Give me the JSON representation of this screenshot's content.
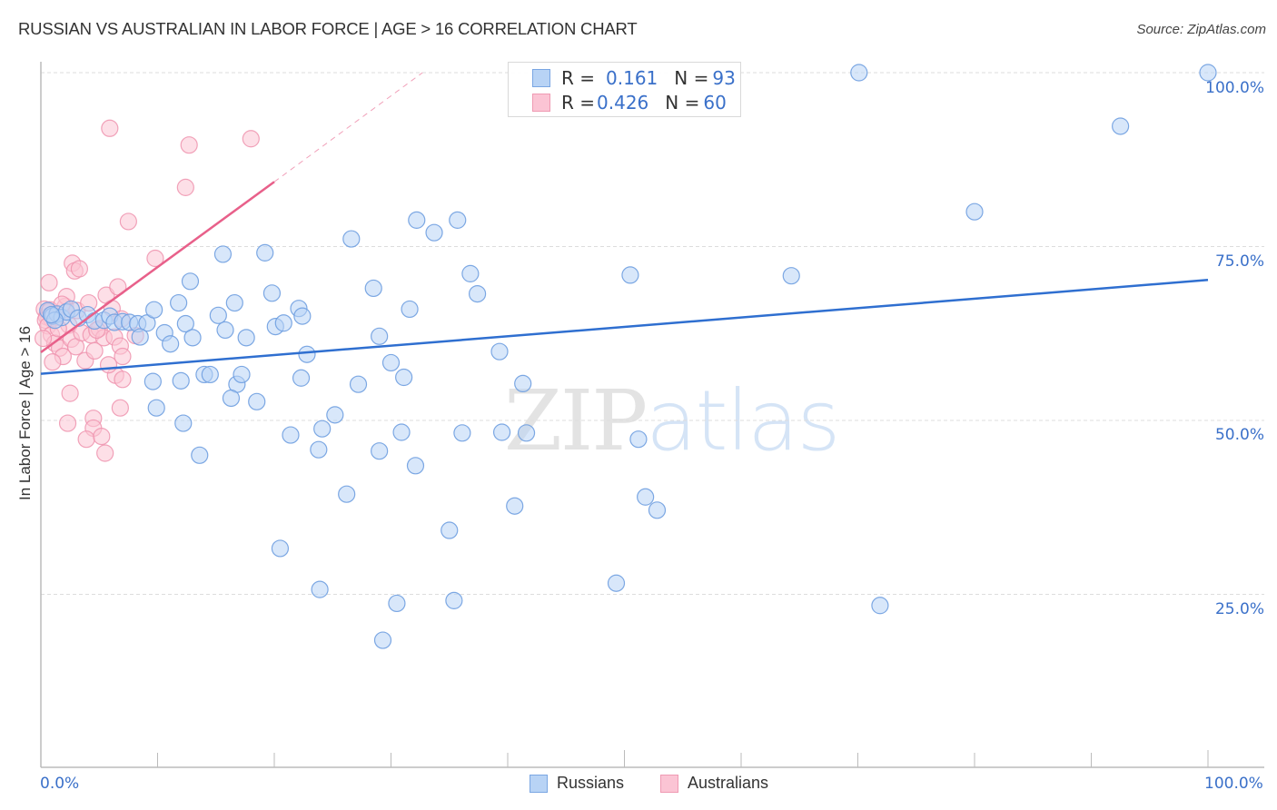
{
  "header": {
    "title": "RUSSIAN VS AUSTRALIAN IN LABOR FORCE | AGE > 16 CORRELATION CHART",
    "source": "Source: ZipAtlas.com"
  },
  "watermark": {
    "zip": "ZIP",
    "atlas": "atlas"
  },
  "stats_legend": [
    {
      "series": "Russians",
      "r_label": "R = ",
      "r_value": "0.161",
      "n_label": "N = ",
      "n_value": "93"
    },
    {
      "series": "Australians",
      "r_label": "R = ",
      "r_value": "0.426",
      "n_label": "N = ",
      "n_value": "60"
    }
  ],
  "colors": {
    "russians_fill": "#b8d3f5",
    "russians_stroke": "#6f9fe0",
    "russians_line": "#2f6fd0",
    "australians_fill": "#fbc4d4",
    "australians_stroke": "#ee93ae",
    "australians_line": "#e8608a",
    "tick_text": "#3a70c9",
    "grid": "#dddddd"
  },
  "chart_data": {
    "type": "scatter",
    "title": "RUSSIAN VS AUSTRALIAN IN LABOR FORCE | AGE > 16 CORRELATION CHART",
    "xlabel": "",
    "ylabel": "In Labor Force | Age > 16",
    "xlim": [
      0,
      100
    ],
    "ylim": [
      0,
      100
    ],
    "x_tick_labels": [
      {
        "value": 0,
        "label": "0.0%"
      },
      {
        "value": 100,
        "label": "100.0%"
      }
    ],
    "y_tick_labels": [
      {
        "value": 25,
        "label": "25.0%"
      },
      {
        "value": 50,
        "label": "50.0%"
      },
      {
        "value": 75,
        "label": "75.0%"
      },
      {
        "value": 100,
        "label": "100.0%"
      }
    ],
    "x_minor_ticks": [
      0,
      10,
      20,
      30,
      40,
      50,
      60,
      70,
      80,
      90,
      100
    ],
    "grid": "horizontal-dashed",
    "legend_position": "bottom-center",
    "legend": [
      "Russians",
      "Australians"
    ],
    "series": [
      {
        "name": "Russians",
        "r": 0.161,
        "n": 93,
        "trend": {
          "x0": 0,
          "y0": 56.7,
          "x1": 100,
          "y1": 70.2
        },
        "points": [
          [
            0.6,
            65.8
          ],
          [
            1.0,
            65.0
          ],
          [
            1.4,
            65.3
          ],
          [
            1.8,
            64.8
          ],
          [
            2.2,
            65.6
          ],
          [
            2.6,
            66.0
          ],
          [
            1.2,
            64.4
          ],
          [
            0.9,
            65.2
          ],
          [
            3.2,
            64.7
          ],
          [
            4.0,
            65.2
          ],
          [
            4.6,
            64.3
          ],
          [
            5.4,
            64.4
          ],
          [
            5.9,
            65.0
          ],
          [
            6.3,
            64.1
          ],
          [
            7.0,
            64.2
          ],
          [
            7.6,
            64.1
          ],
          [
            8.3,
            63.9
          ],
          [
            9.1,
            64.0
          ],
          [
            9.7,
            65.9
          ],
          [
            10.6,
            62.6
          ],
          [
            8.5,
            62.0
          ],
          [
            11.8,
            66.9
          ],
          [
            11.1,
            61.0
          ],
          [
            12.4,
            63.9
          ],
          [
            12.8,
            70.0
          ],
          [
            13.0,
            61.9
          ],
          [
            12.0,
            55.7
          ],
          [
            9.6,
            55.6
          ],
          [
            9.9,
            51.8
          ],
          [
            12.2,
            49.6
          ],
          [
            13.6,
            45.0
          ],
          [
            14.0,
            56.6
          ],
          [
            14.5,
            56.6
          ],
          [
            15.2,
            65.1
          ],
          [
            15.8,
            63.0
          ],
          [
            15.6,
            73.9
          ],
          [
            16.6,
            66.9
          ],
          [
            17.6,
            61.9
          ],
          [
            16.8,
            55.2
          ],
          [
            17.2,
            56.6
          ],
          [
            16.3,
            53.2
          ],
          [
            18.5,
            52.7
          ],
          [
            19.2,
            74.1
          ],
          [
            19.8,
            68.3
          ],
          [
            20.1,
            63.5
          ],
          [
            20.8,
            64.0
          ],
          [
            22.1,
            66.1
          ],
          [
            22.8,
            59.5
          ],
          [
            22.3,
            56.1
          ],
          [
            22.4,
            65.0
          ],
          [
            21.4,
            47.9
          ],
          [
            23.8,
            45.8
          ],
          [
            24.1,
            48.8
          ],
          [
            25.2,
            50.8
          ],
          [
            26.6,
            76.1
          ],
          [
            27.2,
            55.2
          ],
          [
            26.2,
            39.4
          ],
          [
            23.9,
            25.7
          ],
          [
            20.5,
            31.6
          ],
          [
            28.5,
            69.0
          ],
          [
            29.0,
            62.1
          ],
          [
            29.0,
            45.6
          ],
          [
            30.0,
            58.3
          ],
          [
            31.1,
            56.2
          ],
          [
            31.6,
            66.0
          ],
          [
            30.9,
            48.3
          ],
          [
            32.1,
            43.5
          ],
          [
            30.5,
            23.7
          ],
          [
            29.3,
            18.4
          ],
          [
            32.2,
            78.8
          ],
          [
            33.7,
            77.0
          ],
          [
            35.7,
            78.8
          ],
          [
            36.8,
            71.1
          ],
          [
            37.4,
            68.2
          ],
          [
            36.1,
            48.2
          ],
          [
            35.4,
            24.1
          ],
          [
            35.0,
            34.2
          ],
          [
            39.3,
            59.9
          ],
          [
            39.5,
            48.3
          ],
          [
            40.6,
            37.7
          ],
          [
            41.3,
            55.3
          ],
          [
            41.6,
            48.2
          ],
          [
            49.3,
            26.6
          ],
          [
            50.5,
            70.9
          ],
          [
            51.2,
            47.3
          ],
          [
            51.8,
            39.0
          ],
          [
            52.8,
            37.1
          ],
          [
            64.3,
            70.8
          ],
          [
            70.1,
            100.0
          ],
          [
            71.9,
            23.4
          ],
          [
            80.0,
            80.0
          ],
          [
            92.5,
            92.3
          ],
          [
            100.0,
            100.0
          ]
        ]
      },
      {
        "name": "Australians",
        "r": 0.426,
        "n": 60,
        "trend": {
          "x0": 0,
          "y0": 59.8,
          "x1": 20,
          "y1": 84.3,
          "dashed_to_x": 32.7,
          "dashed_to_y": 100
        },
        "points": [
          [
            0.3,
            66.0
          ],
          [
            0.5,
            64.9
          ],
          [
            0.7,
            65.6
          ],
          [
            0.9,
            64.6
          ],
          [
            1.1,
            65.4
          ],
          [
            0.4,
            64.4
          ],
          [
            0.8,
            65.9
          ],
          [
            1.3,
            64.8
          ],
          [
            0.6,
            63.6
          ],
          [
            0.9,
            62.3
          ],
          [
            1.2,
            61.1
          ],
          [
            1.6,
            60.4
          ],
          [
            1.9,
            59.2
          ],
          [
            1.0,
            58.4
          ],
          [
            0.7,
            69.8
          ],
          [
            2.1,
            66.4
          ],
          [
            2.4,
            63.7
          ],
          [
            2.6,
            61.7
          ],
          [
            2.2,
            67.8
          ],
          [
            3.0,
            60.6
          ],
          [
            3.5,
            62.6
          ],
          [
            3.1,
            65.8
          ],
          [
            3.8,
            58.6
          ],
          [
            4.3,
            62.3
          ],
          [
            4.1,
            66.9
          ],
          [
            4.6,
            60.0
          ],
          [
            5.0,
            63.2
          ],
          [
            5.4,
            61.9
          ],
          [
            2.7,
            72.6
          ],
          [
            2.9,
            71.5
          ],
          [
            3.3,
            71.8
          ],
          [
            5.6,
            68.0
          ],
          [
            6.1,
            66.1
          ],
          [
            6.3,
            62.0
          ],
          [
            6.6,
            69.2
          ],
          [
            6.8,
            60.7
          ],
          [
            7.0,
            59.2
          ],
          [
            6.4,
            56.5
          ],
          [
            7.0,
            55.9
          ],
          [
            6.8,
            51.8
          ],
          [
            2.5,
            53.9
          ],
          [
            2.3,
            49.6
          ],
          [
            4.5,
            50.3
          ],
          [
            4.5,
            48.9
          ],
          [
            3.9,
            47.3
          ],
          [
            5.2,
            47.7
          ],
          [
            5.5,
            45.3
          ],
          [
            7.5,
            78.6
          ],
          [
            9.8,
            73.3
          ],
          [
            5.9,
            92.0
          ],
          [
            12.7,
            89.6
          ],
          [
            12.4,
            83.5
          ],
          [
            18.0,
            90.5
          ],
          [
            1.5,
            63.2
          ],
          [
            0.2,
            61.8
          ],
          [
            8.1,
            62.2
          ],
          [
            5.8,
            58.0
          ],
          [
            6.9,
            64.6
          ],
          [
            1.8,
            66.7
          ],
          [
            4.8,
            63.0
          ]
        ]
      }
    ]
  },
  "bottom_legend": [
    {
      "label": "Russians",
      "swatch": "blue"
    },
    {
      "label": "Australians",
      "swatch": "pink"
    }
  ]
}
